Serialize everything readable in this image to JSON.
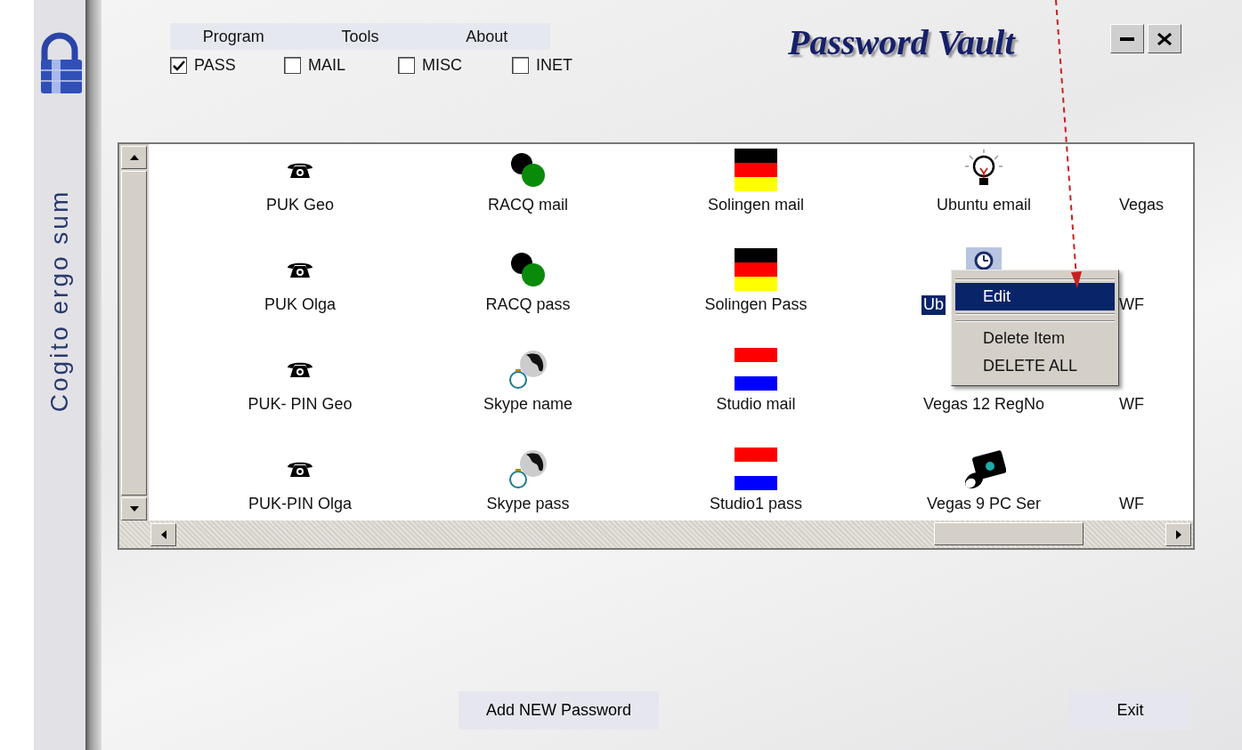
{
  "sidebar": {
    "motto": "Cogito ergo sum"
  },
  "menu_bar": [
    "Program",
    "Tools",
    "About"
  ],
  "filters": [
    {
      "label": "PASS",
      "checked": true
    },
    {
      "label": "MAIL",
      "checked": false
    },
    {
      "label": "MISC",
      "checked": false
    },
    {
      "label": "INET",
      "checked": false
    }
  ],
  "title": "Password Vault",
  "window_buttons": [
    {
      "kind": "minimize"
    },
    {
      "kind": "close"
    }
  ],
  "list": {
    "rows": [
      [
        {
          "label": "PUK Geo",
          "kind": "phone",
          "selected": false
        },
        {
          "label": "RACQ mail",
          "kind": "dots",
          "selected": false
        },
        {
          "label": "Solingen mail",
          "kind": "flag-de",
          "selected": false
        },
        {
          "label": "Ubuntu email",
          "kind": "bulb",
          "selected": false
        },
        {
          "label": "Vegas",
          "kind": "none",
          "selected": false
        }
      ],
      [
        {
          "label": "PUK Olga",
          "kind": "phone",
          "selected": false
        },
        {
          "label": "RACQ pass",
          "kind": "dots",
          "selected": false
        },
        {
          "label": "Solingen Pass",
          "kind": "flag-de",
          "selected": false
        },
        {
          "label": "Ub",
          "kind": "clock",
          "selected": true
        },
        {
          "label": "WF",
          "kind": "none",
          "selected": false
        }
      ],
      [
        {
          "label": "PUK- PIN Geo",
          "kind": "phone",
          "selected": false
        },
        {
          "label": "Skype name",
          "kind": "globe",
          "selected": false
        },
        {
          "label": "Studio mail",
          "kind": "flag-nl",
          "selected": false
        },
        {
          "label": "Vegas 12 RegNo",
          "kind": "none",
          "selected": false
        },
        {
          "label": "WF",
          "kind": "none",
          "selected": false
        }
      ],
      [
        {
          "label": "PUK-PIN Olga",
          "kind": "phone",
          "selected": false
        },
        {
          "label": "Skype pass",
          "kind": "globe",
          "selected": false
        },
        {
          "label": "Studio1 pass",
          "kind": "flag-nl",
          "selected": false
        },
        {
          "label": "Vegas 9 PC Ser",
          "kind": "camera",
          "selected": false
        },
        {
          "label": "WF",
          "kind": "none",
          "selected": false
        }
      ]
    ]
  },
  "context_menu": [
    {
      "kind": "separator"
    },
    {
      "kind": "item",
      "label": "Edit",
      "selected": true
    },
    {
      "kind": "separator"
    },
    {
      "kind": "separator"
    },
    {
      "kind": "item",
      "label": "Delete Item",
      "selected": false
    },
    {
      "kind": "item",
      "label": "DELETE ALL",
      "selected": false
    }
  ],
  "buttons": [
    {
      "label": "Add NEW Password",
      "kind": "add"
    },
    {
      "label": "Exit",
      "kind": "exit"
    }
  ]
}
